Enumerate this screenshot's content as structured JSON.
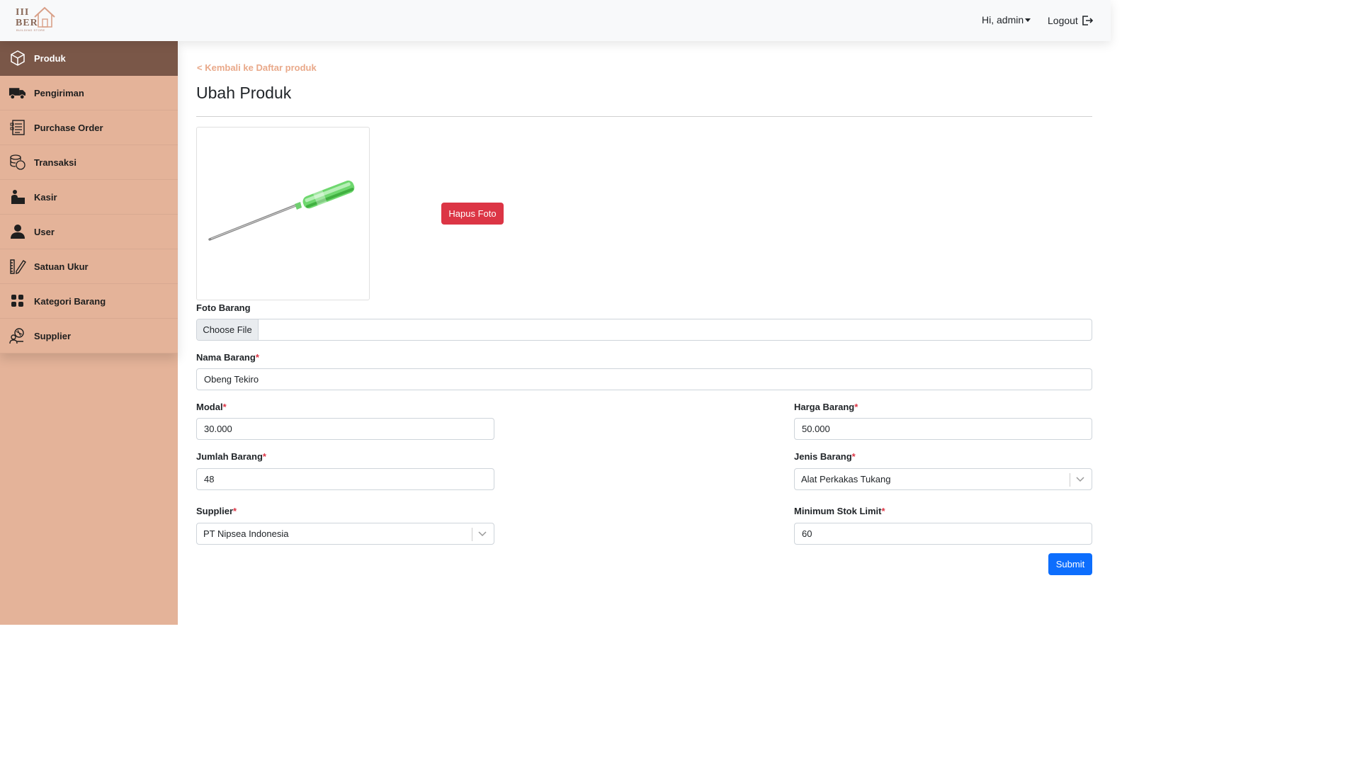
{
  "header": {
    "logo_line1": "III",
    "logo_line2": "BER",
    "logo_sub": "BUILDING STORE",
    "user_greeting": "Hi, admin",
    "logout_label": "Logout"
  },
  "sidebar": {
    "items": [
      {
        "label": "Produk",
        "icon": "box-icon",
        "active": true
      },
      {
        "label": "Pengiriman",
        "icon": "truck-icon",
        "active": false
      },
      {
        "label": "Purchase Order",
        "icon": "order-list-icon",
        "active": false
      },
      {
        "label": "Transaksi",
        "icon": "coins-icon",
        "active": false
      },
      {
        "label": "Kasir",
        "icon": "cashier-icon",
        "active": false
      },
      {
        "label": "User",
        "icon": "user-icon",
        "active": false
      },
      {
        "label": "Satuan Ukur",
        "icon": "ruler-pencil-icon",
        "active": false
      },
      {
        "label": "Kategori Barang",
        "icon": "category-grid-icon",
        "active": false
      },
      {
        "label": "Supplier",
        "icon": "supplier-icon",
        "active": false
      }
    ]
  },
  "main": {
    "back_link": "< Kembali ke Daftar produk",
    "title": "Ubah Produk",
    "delete_photo_label": "Hapus Foto",
    "form": {
      "foto_label": "Foto Barang",
      "file_button": "Choose File",
      "nama_label": "Nama Barang",
      "nama_value": "Obeng Tekiro",
      "modal_label": "Modal",
      "modal_value": "30.000",
      "harga_label": "Harga Barang",
      "harga_value": "50.000",
      "jumlah_label": "Jumlah Barang",
      "jumlah_value": "48",
      "jenis_label": "Jenis Barang",
      "jenis_value": "Alat Perkakas Tukang",
      "supplier_label": "Supplier",
      "supplier_value": "PT Nipsea Indonesia",
      "minstok_label": "Minimum Stok Limit",
      "minstok_value": "60",
      "required_mark": "*",
      "submit_label": "Submit"
    }
  },
  "colors": {
    "sidebar_bg": "#e4b399",
    "sidebar_active": "#7a5748",
    "danger": "#dc3545",
    "primary": "#0d6efd",
    "link": "#e9a98a"
  }
}
